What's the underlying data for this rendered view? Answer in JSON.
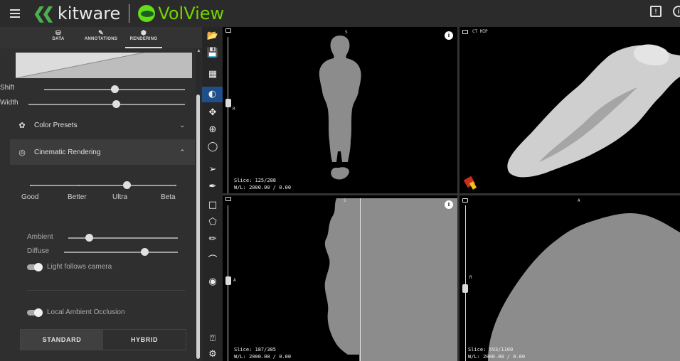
{
  "appbar": {
    "menu_icon": "hamburger-icon",
    "brand_left": "kitware",
    "brand_right": "VolView",
    "icons": [
      "feedback-icon",
      "info-icon"
    ],
    "info_glyph": "i"
  },
  "tabs": [
    {
      "label": "DATA",
      "icon": "database-icon",
      "glyph": "⛁"
    },
    {
      "label": "ANNOTATIONS",
      "icon": "pencil-icon",
      "glyph": "✎"
    },
    {
      "label": "RENDERING",
      "icon": "cube-icon",
      "glyph": "⬢"
    }
  ],
  "active_tab": "RENDERING",
  "rendering": {
    "shift_label": "Shift",
    "shift_value": 0.58,
    "width_label": "Width",
    "width_value": 0.58,
    "color_presets_label": "Color Presets",
    "cinematic_label": "Cinematic Rendering",
    "quality_options": [
      "Good",
      "Better",
      "Ultra",
      "Beta"
    ],
    "quality_selected": "Ultra",
    "ambient_label": "Ambient",
    "ambient_value": 0.2,
    "diffuse_label": "Diffuse",
    "diffuse_value": 0.7,
    "light_follows_label": "Light follows camera",
    "light_follows": true,
    "local_ao_label": "Local Ambient Occlusion",
    "local_ao": true,
    "mode_options": [
      "STANDARD",
      "HYBRID"
    ],
    "mode_selected": "STANDARD"
  },
  "tools": [
    "folder-open-icon",
    "save-icon",
    "layout-icon",
    "window-level-icon",
    "pan-icon",
    "zoom-icon",
    "crosshairs-icon",
    "select-icon",
    "paint-icon",
    "rectangle-icon",
    "polygon-icon",
    "ruler-icon",
    "crop-icon",
    "screenshot-icon",
    "notifications-icon",
    "settings-icon"
  ],
  "active_tool": "window-level-icon",
  "views": {
    "coronal": {
      "top_label": "S",
      "side_label": "R",
      "slice": "Slice: 125/288",
      "wl": "W/L: 2000.00 / 0.00",
      "info_glyph": "i"
    },
    "volume": {
      "title": "CT MIP"
    },
    "sagittal": {
      "top_label": "S",
      "side_label": "A",
      "slice": "Slice: 187/385",
      "wl": "W/L: 2000.00 / 0.00",
      "info_glyph": "i"
    },
    "axial": {
      "top_label": "A",
      "side_label": "R",
      "slice": "Slice: 593/1100",
      "wl": "W/L: 2000.00 / 0.00"
    }
  }
}
